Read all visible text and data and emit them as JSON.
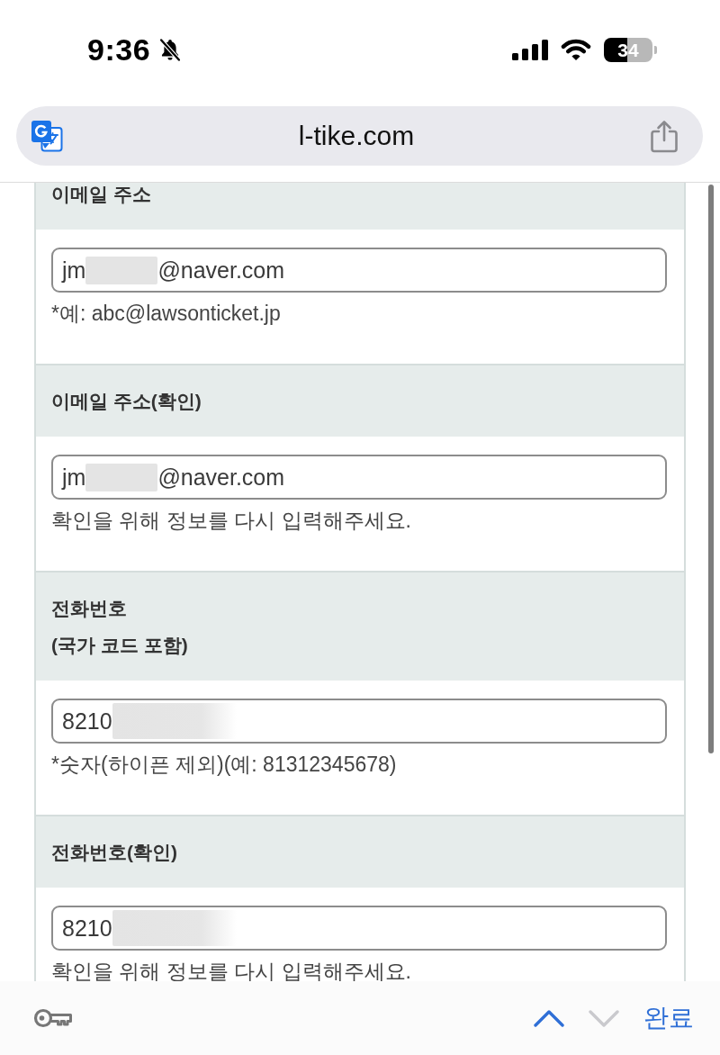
{
  "status_bar": {
    "time": "9:36",
    "silent": true,
    "battery": "34"
  },
  "address_bar": {
    "url": "l-tike.com"
  },
  "form": {
    "sections": [
      {
        "label": [
          "이메일 주소"
        ],
        "field": {
          "value_start": "jm",
          "redacted": true,
          "value_end": "@naver.com"
        },
        "hint": "*예: abc@lawsonticket.jp"
      },
      {
        "label": [
          "이메일 주소(확인)"
        ],
        "field": {
          "value_start": "jm",
          "redacted": true,
          "value_end": "@naver.com"
        },
        "hint": "확인을 위해 정보를 다시 입력해주세요."
      },
      {
        "label": [
          "전화번호",
          "(국가 코드 포함)"
        ],
        "field": {
          "value_start": "8210",
          "redacted": true
        },
        "hint": "*숫자(하이픈 제외)(예: 81312345678)"
      },
      {
        "label": [
          "전화번호(확인)"
        ],
        "field": {
          "value_start": "8210",
          "redacted": true
        },
        "hint": "확인을 위해 정보를 다시 입력해주세요."
      }
    ]
  },
  "keyboard_toolbar": {
    "previous": {
      "disabled": false
    },
    "next": {
      "disabled": true
    },
    "done": "완료"
  }
}
